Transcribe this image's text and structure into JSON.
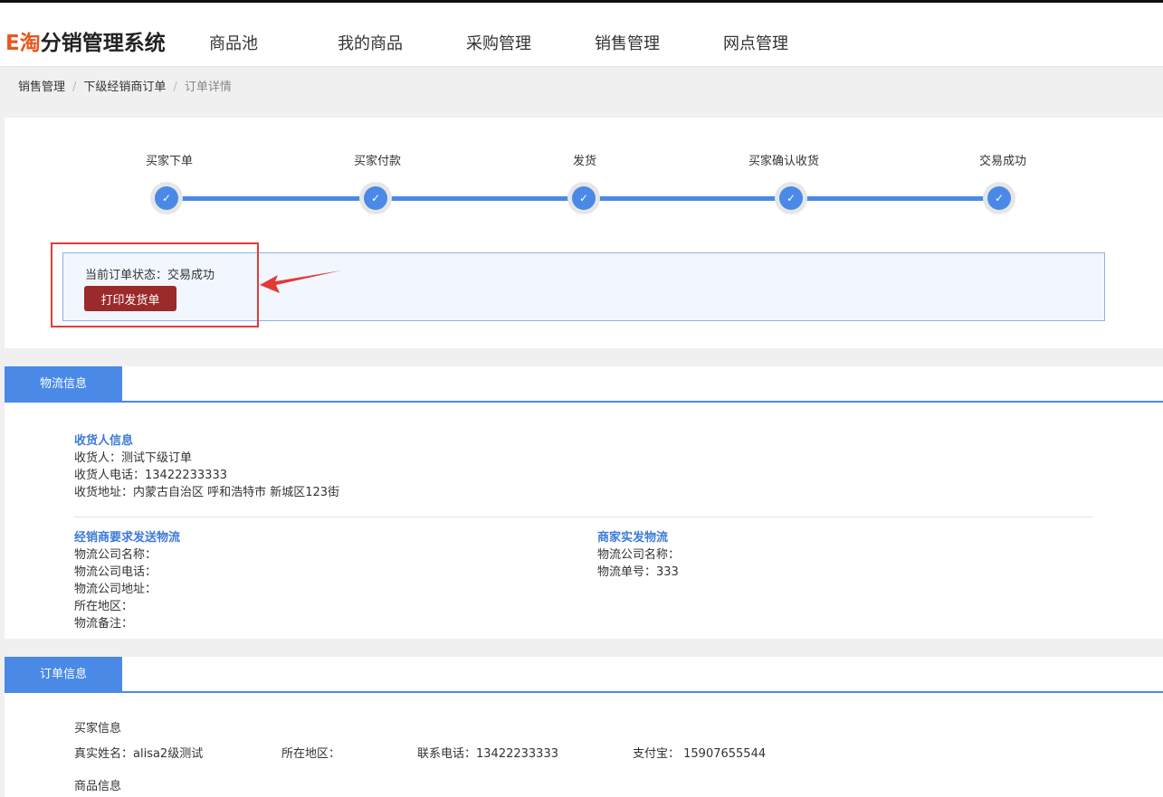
{
  "header": {
    "logo_e": "E淘",
    "logo_rest": "分销管理系统",
    "nav": [
      "商品池",
      "我的商品",
      "采购管理",
      "销售管理",
      "网点管理"
    ]
  },
  "breadcrumb": [
    "销售管理",
    "下级经销商订单",
    "订单详情"
  ],
  "steps": [
    "买家下单",
    "买家付款",
    "发货",
    "买家确认收货",
    "交易成功"
  ],
  "status": {
    "text": "当前订单状态：交易成功",
    "print_button": "打印发货单"
  },
  "logistics": {
    "tab": "物流信息",
    "receiver_title": "收货人信息",
    "receiver": "收货人：测试下级订单",
    "receiver_phone": "收货人电话：13422233333",
    "receiver_address": "收货地址：内蒙古自治区 呼和浩特市 新城区123街",
    "dealer_title": "经销商要求发送物流",
    "dealer_fields": [
      "物流公司名称：",
      "物流公司电话：",
      "物流公司地址：",
      "所在地区：",
      "物流备注："
    ],
    "merchant_title": "商家实发物流",
    "merchant_fields": [
      "物流公司名称：",
      "物流单号：333"
    ]
  },
  "order": {
    "tab": "订单信息",
    "buyer_title": "买家信息",
    "buyer_name": "真实姓名：alisa2级测试",
    "buyer_region": "所在地区：",
    "buyer_phone": "联系电话：13422233333",
    "buyer_alipay": "支付宝： 15907655544",
    "goods_title": "商品信息"
  }
}
